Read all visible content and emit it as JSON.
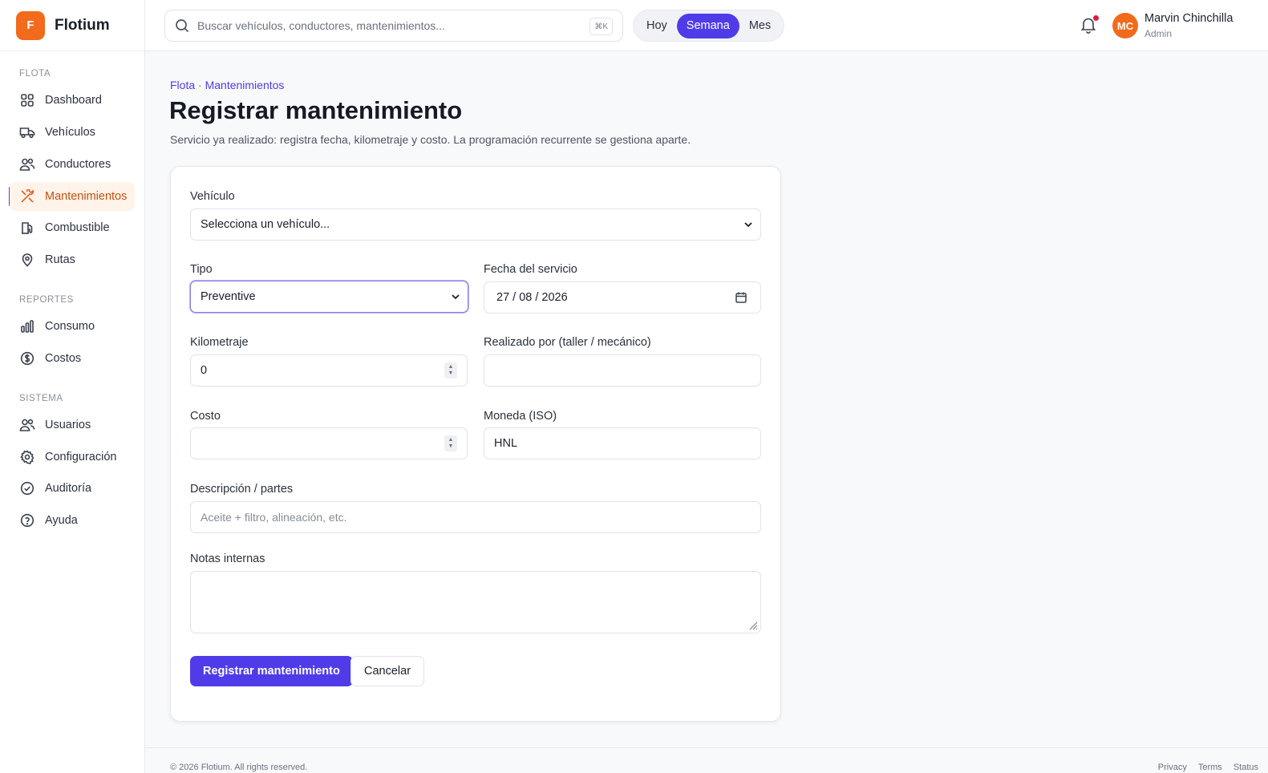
{
  "app": {
    "logo_letter": "F",
    "name": "Flotium"
  },
  "sidebar": {
    "sections": [
      {
        "title": "FLOTA"
      },
      {
        "title": "REPORTES"
      },
      {
        "title": "SISTEMA"
      }
    ],
    "items": [
      {
        "label": "Dashboard",
        "icon": "grid-icon"
      },
      {
        "label": "Vehículos",
        "icon": "truck-icon"
      },
      {
        "label": "Conductores",
        "icon": "users-icon"
      },
      {
        "label": "Mantenimientos",
        "icon": "wrench-icon",
        "active": true
      },
      {
        "label": "Combustible",
        "icon": "fuel-icon"
      },
      {
        "label": "Rutas",
        "icon": "map-pin-icon"
      },
      {
        "label": "Consumo",
        "icon": "bar-chart-icon"
      },
      {
        "label": "Costos",
        "icon": "dollar-icon"
      },
      {
        "label": "Usuarios",
        "icon": "users-icon"
      },
      {
        "label": "Configuración",
        "icon": "gear-icon"
      },
      {
        "label": "Auditoría",
        "icon": "check-circle-icon"
      },
      {
        "label": "Ayuda",
        "icon": "help-icon"
      }
    ]
  },
  "topbar": {
    "search_placeholder": "Buscar vehículos, conductores, mantenimientos...",
    "shortcut": "⌘K",
    "range": {
      "options": [
        "Hoy",
        "Semana",
        "Mes"
      ],
      "selected": "Semana"
    },
    "user": {
      "initials": "MC",
      "name": "Marvin Chinchilla",
      "role": "Admin"
    }
  },
  "page": {
    "breadcrumb": {
      "parent": "Flota",
      "separator": "·",
      "current": "Mantenimientos"
    },
    "title": "Registrar mantenimiento",
    "subtitle": "Servicio ya realizado: registra fecha, kilometraje y costo. La programación recurrente se gestiona aparte."
  },
  "form": {
    "vehicle": {
      "label": "Vehículo",
      "value": "Selecciona un vehículo..."
    },
    "type": {
      "label": "Tipo",
      "value": "Preventive"
    },
    "date": {
      "label": "Fecha del servicio",
      "value": "27 / 08 / 2026"
    },
    "mileage": {
      "label": "Kilometraje",
      "value": "0"
    },
    "performed_by": {
      "label": "Realizado por (taller / mecánico)",
      "value": ""
    },
    "cost": {
      "label": "Costo",
      "value": ""
    },
    "currency": {
      "label": "Moneda (ISO)",
      "value": "HNL"
    },
    "description": {
      "label": "Descripción / partes",
      "placeholder": "Aceite + filtro, alineación, etc."
    },
    "notes": {
      "label": "Notas internas",
      "value": ""
    },
    "submit_label": "Registrar mantenimiento",
    "cancel_label": "Cancelar"
  },
  "footer": {
    "copyright": "© 2026 Flotium. All rights reserved.",
    "links": [
      "Privacy",
      "Terms",
      "Status"
    ]
  },
  "colors": {
    "accent": "#4f3ce8",
    "brand": "#f26a1b",
    "active_bg": "#fff3ea"
  }
}
